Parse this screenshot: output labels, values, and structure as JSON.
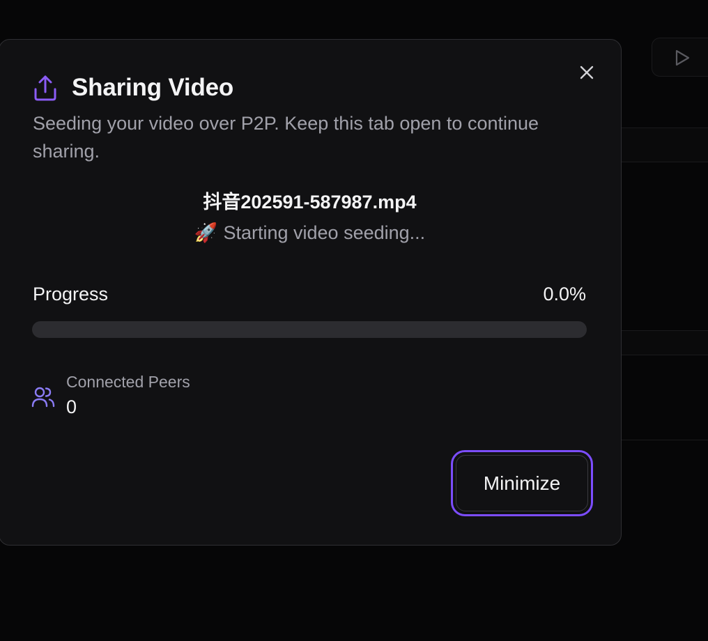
{
  "dialog": {
    "title": "Sharing Video",
    "subtitle": "Seeding your video over P2P. Keep this tab open to continue sharing.",
    "file_name": "抖音202591-587987.mp4",
    "status": {
      "emoji": "🚀",
      "text": "Starting video seeding..."
    },
    "progress": {
      "label": "Progress",
      "value_text": "0.0%",
      "fraction": 0.0
    },
    "peers": {
      "label": "Connected Peers",
      "count": "0"
    },
    "minimize_label": "Minimize",
    "icons": {
      "header": "share-upload-icon",
      "close": "close-icon",
      "peers": "users-icon",
      "background_play": "play-icon"
    }
  },
  "colors": {
    "accent": "#7c4dff",
    "panel": "#111113",
    "page": "#050505",
    "muted_text": "#a1a1aa",
    "track": "#2c2c30",
    "peers_icon": "#8b7cf6"
  }
}
